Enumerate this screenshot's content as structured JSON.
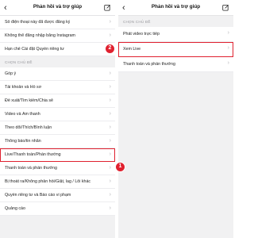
{
  "left": {
    "title": "Phản hồi và trợ giúp",
    "top_rows": [
      {
        "label": "Số điện thoại này đã được đăng ký"
      },
      {
        "label": "Không thể đăng nhập bằng Instagram"
      },
      {
        "label": "Hạn chế Cài đặt Quyền riêng tư"
      }
    ],
    "section": "CHỌN CHỦ ĐỀ",
    "topics": [
      {
        "label": "Góp ý"
      },
      {
        "label": "Tài khoản và Hồ sơ"
      },
      {
        "label": "Đề xuất/Tìm kiếm/Chia sẻ"
      },
      {
        "label": "Video và Âm thanh"
      },
      {
        "label": "Theo dõi/Thích/Bình luận"
      },
      {
        "label": "Thông báo/tin nhắn"
      },
      {
        "label": "Live/Thanh toán/Phần thưởng"
      },
      {
        "label": "Thanh toán và phần thưởng"
      },
      {
        "label": "Bị thoát ra/Không phản hồi/Giật, lag / Lỗi khác"
      },
      {
        "label": "Quyền riêng tư và Báo cáo vi phạm"
      },
      {
        "label": "Quảng cáo"
      }
    ]
  },
  "right": {
    "title": "Phản hồi và trợ giúp",
    "section": "CHỌN CHỦ ĐỀ",
    "topics": [
      {
        "label": "Phát video trực tiếp"
      },
      {
        "label": "Xem Live"
      },
      {
        "label": "Thanh toán và phần thưởng"
      }
    ]
  },
  "badges": {
    "step1": "1",
    "step2": "2"
  },
  "icons": {
    "back": "chevron-left-icon",
    "edit": "edit-icon",
    "row": "chevron-right-icon"
  },
  "colors": {
    "highlight": "#e0212f",
    "background": "#f1f1f2"
  }
}
